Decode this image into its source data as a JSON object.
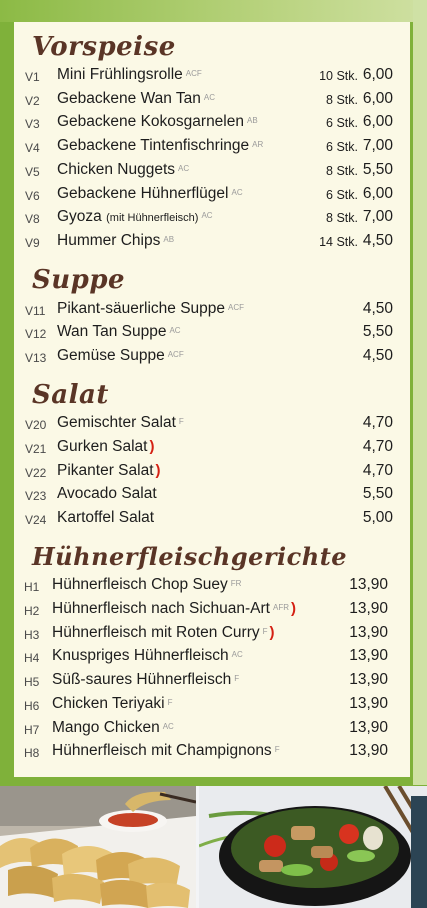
{
  "menu": {
    "sections": [
      {
        "title": "Vorspeise",
        "items": [
          {
            "code": "V1",
            "name": "Mini Frühlingsrolle",
            "note": "",
            "allergens": "ACF",
            "chili": false,
            "qty": "10 Stk.",
            "price": "6,00"
          },
          {
            "code": "V2",
            "name": "Gebackene Wan Tan",
            "note": "",
            "allergens": "AC",
            "chili": false,
            "qty": "8 Stk.",
            "price": "6,00"
          },
          {
            "code": "V3",
            "name": "Gebackene Kokosgarnelen",
            "note": "",
            "allergens": "AB",
            "chili": false,
            "qty": "6 Stk.",
            "price": "6,00"
          },
          {
            "code": "V4",
            "name": "Gebackene Tintenfischringe",
            "note": "",
            "allergens": "AR",
            "chili": false,
            "qty": "6 Stk.",
            "price": "7,00"
          },
          {
            "code": "V5",
            "name": "Chicken Nuggets",
            "note": "",
            "allergens": "AC",
            "chili": false,
            "qty": "8 Stk.",
            "price": "5,50"
          },
          {
            "code": "V6",
            "name": "Gebackene Hühnerflügel",
            "note": "",
            "allergens": "AC",
            "chili": false,
            "qty": "6 Stk.",
            "price": "6,00"
          },
          {
            "code": "V8",
            "name": "Gyoza",
            "note": "(mit Hühnerfleisch)",
            "allergens": "AC",
            "chili": false,
            "qty": "8 Stk.",
            "price": "7,00"
          },
          {
            "code": "V9",
            "name": "Hummer Chips",
            "note": "",
            "allergens": "AB",
            "chili": false,
            "qty": "14 Stk.",
            "price": "4,50"
          }
        ]
      },
      {
        "title": "Suppe",
        "items": [
          {
            "code": "V11",
            "name": "Pikant-säuerliche Suppe",
            "note": "",
            "allergens": "ACF",
            "chili": false,
            "qty": "",
            "price": "4,50"
          },
          {
            "code": "V12",
            "name": "Wan Tan Suppe",
            "note": "",
            "allergens": "AC",
            "chili": false,
            "qty": "",
            "price": "5,50"
          },
          {
            "code": "V13",
            "name": "Gemüse Suppe",
            "note": "",
            "allergens": "ACF",
            "chili": false,
            "qty": "",
            "price": "4,50"
          }
        ]
      },
      {
        "title": "Salat",
        "items": [
          {
            "code": "V20",
            "name": "Gemischter Salat",
            "note": "",
            "allergens": "F",
            "chili": false,
            "qty": "",
            "price": "4,70"
          },
          {
            "code": "V21",
            "name": "Gurken Salat",
            "note": "",
            "allergens": "",
            "chili": true,
            "qty": "",
            "price": "4,70"
          },
          {
            "code": "V22",
            "name": "Pikanter Salat",
            "note": "",
            "allergens": "",
            "chili": true,
            "qty": "",
            "price": "4,70"
          },
          {
            "code": "V23",
            "name": "Avocado Salat",
            "note": "",
            "allergens": "",
            "chili": false,
            "qty": "",
            "price": "5,50"
          },
          {
            "code": "V24",
            "name": "Kartoffel Salat",
            "note": "",
            "allergens": "",
            "chili": false,
            "qty": "",
            "price": "5,00"
          }
        ]
      },
      {
        "title": "Hühnerfleischgerichte",
        "items": [
          {
            "code": "H1",
            "name": "Hühnerfleisch Chop Suey",
            "note": "",
            "allergens": "FR",
            "chili": false,
            "qty": "",
            "price": "13,90"
          },
          {
            "code": "H2",
            "name": "Hühnerfleisch nach Sichuan-Art",
            "note": "",
            "allergens": "AFR",
            "chili": true,
            "qty": "",
            "price": "13,90"
          },
          {
            "code": "H3",
            "name": "Hühnerfleisch mit Roten Curry",
            "note": "",
            "allergens": "F",
            "chili": true,
            "qty": "",
            "price": "13,90"
          },
          {
            "code": "H4",
            "name": "Knuspriges Hühnerfleisch",
            "note": "",
            "allergens": "AC",
            "chili": false,
            "qty": "",
            "price": "13,90"
          },
          {
            "code": "H5",
            "name": "Süß-saures Hühnerfleisch",
            "note": "",
            "allergens": "F",
            "chili": false,
            "qty": "",
            "price": "13,90"
          },
          {
            "code": "H6",
            "name": "Chicken Teriyaki",
            "note": "",
            "allergens": "F",
            "chili": false,
            "qty": "",
            "price": "13,90"
          },
          {
            "code": "H7",
            "name": "Mango Chicken",
            "note": "",
            "allergens": "AC",
            "chili": false,
            "qty": "",
            "price": "13,90"
          },
          {
            "code": "H8",
            "name": "Hühnerfleisch mit Champignons",
            "note": "",
            "allergens": "F",
            "chili": false,
            "qty": "",
            "price": "13,90"
          }
        ]
      }
    ],
    "chili_icon": "chili-pepper-icon",
    "colors": {
      "frame_green": "#7fb13a",
      "panel": "#fbf9e6",
      "heading_brown": "#5a3526",
      "chili_red": "#d42013"
    }
  },
  "photos": [
    {
      "subject": "gyoza-dumplings-photo"
    },
    {
      "subject": "chicken-vegetable-stirfry-bowl-photo"
    }
  ]
}
